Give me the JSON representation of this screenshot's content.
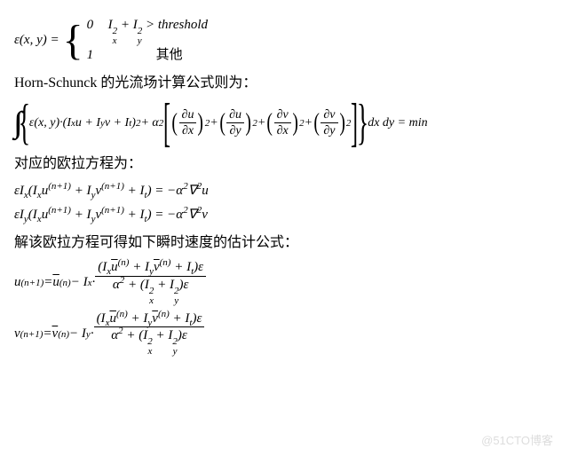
{
  "eq1": {
    "lhs": "ε(x, y) = ",
    "case1_col1": "0",
    "case1_col2_a": "I",
    "case1_col2_b": " + I",
    "case1_col2_c": " > threshold",
    "case2_col1": "1",
    "case2_col2": "其他"
  },
  "p1": "Horn-Schunck 的光流场计算公式则为：",
  "eq2": {
    "pre": "ε(x, y)·(I",
    "u": "u + I",
    "v": "v + I",
    "close": ")",
    "plus_a2": " + α",
    "du_dx_n": "∂u",
    "du_dx_d": "∂x",
    "du_dy_n": "∂u",
    "du_dy_d": "∂y",
    "dv_dx_n": "∂v",
    "dv_dx_d": "∂x",
    "dv_dy_n": "∂v",
    "dv_dy_d": "∂y",
    "tail": " dx dy = min"
  },
  "p2": "对应的欧拉方程为：",
  "eq3": {
    "a": "εI",
    "b": "(I",
    "c": "u",
    "d": " + I",
    "e": "v",
    "f": " + I",
    "g": ") = −α",
    "h": "∇",
    "u": "u"
  },
  "eq4": {
    "a": "εI",
    "b": "(I",
    "c": "u",
    "d": " + I",
    "e": "v",
    "f": " + I",
    "g": ") = −α",
    "h": "∇",
    "v": "v"
  },
  "p3": "解该欧拉方程可得如下瞬时速度的估计公式：",
  "eq5": {
    "lhs_a": "u",
    "lhs_b": " = ",
    "ubar": "u",
    "minus": " − I",
    "dot": " · ",
    "num_a": "(I",
    "num_ub": "u",
    "num_b": " + I",
    "num_vb": "v",
    "num_c": " + I",
    "num_d": ")ε",
    "den_a": "α",
    "den_b": " + (I",
    "den_c": " + I",
    "den_d": ")ε"
  },
  "eq6": {
    "lhs_a": "v",
    "lhs_b": " = ",
    "vbar": "v",
    "minus": " − I",
    "dot": " · ",
    "num_a": "(I",
    "num_ub": "u",
    "num_b": " + I",
    "num_vb": "v",
    "num_c": " + I",
    "num_d": ")ε",
    "den_a": "α",
    "den_b": " + (I",
    "den_c": " + I",
    "den_d": ")ε"
  },
  "sub": {
    "x": "x",
    "y": "y",
    "t": "t"
  },
  "sup": {
    "two": "2",
    "n": "(n)",
    "n1": "(n+1)"
  },
  "watermark": "@51CTO博客",
  "chart_data": {
    "type": "table",
    "title": "Equations on page",
    "equations": [
      "ε(x,y) = { 0 if I_x^2 + I_y^2 > threshold ; 1 otherwise }",
      "∬ { ε(x,y)·(I_x u + I_y v + I_t)^2 + α^2 [ (∂u/∂x)^2 + (∂u/∂y)^2 + (∂v/∂x)^2 + (∂v/∂y)^2 ] } dx dy = min",
      "ε I_x (I_x u^(n+1) + I_y v^(n+1) + I_t) = -α^2 ∇^2 u",
      "ε I_y (I_x u^(n+1) + I_y v^(n+1) + I_t) = -α^2 ∇^2 v",
      "u^(n+1) = ū^(n) - I_x · (I_x ū^(n) + I_y v̄^(n) + I_t) ε / ( α^2 + (I_x^2 + I_y^2) ε )",
      "v^(n+1) = v̄^(n) - I_y · (I_x ū^(n) + I_y v̄^(n) + I_t) ε / ( α^2 + (I_x^2 + I_y^2) ε )"
    ]
  }
}
